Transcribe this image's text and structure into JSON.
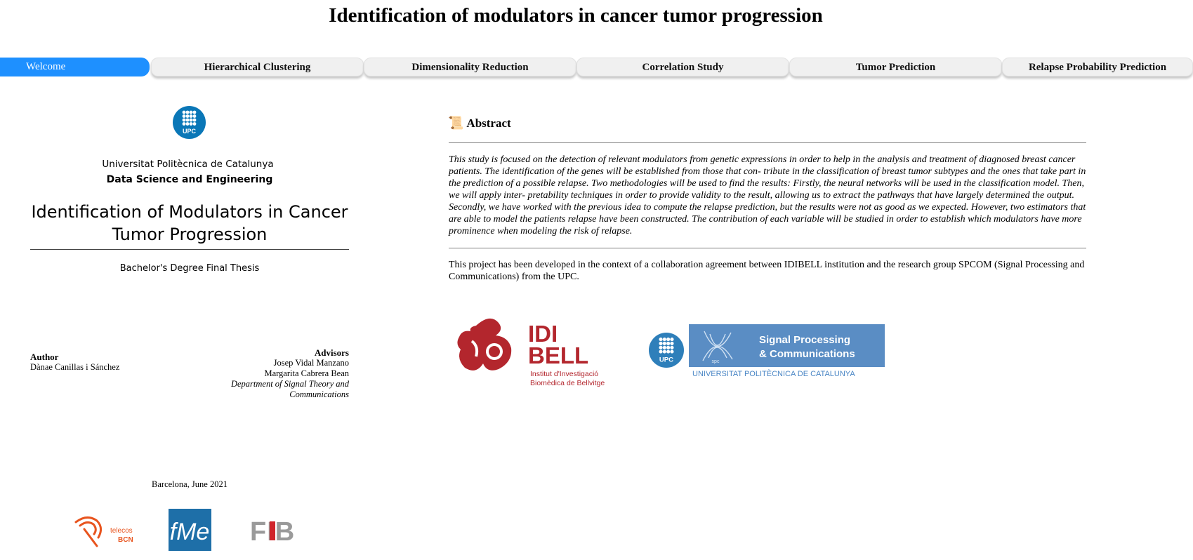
{
  "app": {
    "title": "Identification of modulators in cancer tumor progression"
  },
  "tabs": [
    {
      "label": "Welcome",
      "active": true
    },
    {
      "label": "Hierarchical Clustering",
      "active": false
    },
    {
      "label": "Dimensionality Reduction",
      "active": false
    },
    {
      "label": "Correlation Study",
      "active": false
    },
    {
      "label": "Tumor Prediction",
      "active": false
    },
    {
      "label": "Relapse Probability Prediction",
      "active": false
    }
  ],
  "cover": {
    "logo_text": "UPC",
    "university": "Universitat Politècnica de Catalunya",
    "department": "Data Science and Engineering",
    "title_line1": "Identification of Modulators in Cancer",
    "title_line2": "Tumor Progression",
    "degree": "Bachelor's Degree Final Thesis",
    "author_heading": "Author",
    "author_name": "Dànae Canillas i Sánchez",
    "advisors_heading": "Advisors",
    "advisor_1": "Josep Vidal Manzano",
    "advisor_2": "Margarita Cabrera Bean",
    "advisors_dept": "Department of Signal Theory and Communications",
    "place_date": "Barcelona, June 2021",
    "footer_logos": {
      "telecos_line1": "telecos",
      "telecos_line2": "BCN",
      "fme": "fMe",
      "fib": "FIB"
    }
  },
  "abstract": {
    "icon": "📜",
    "heading": "Abstract",
    "text": "This study is focused on the detection of relevant modulators from genetic expressions in order to help in the analysis and treatment of diagnosed breast cancer patients. The identification of the genes will be established from those that con- tribute in the classification of breast tumor subtypes and the ones that take part in the prediction of a possible relapse. Two methodologies will be used to find the results: Firstly, the neural networks will be used in the classification model. Then, we will apply inter- pretability techniques in order to provide validity to the result, allowing us to extract the pathways that have largely determined the output. Secondly, we have worked with the previous idea to compute the relapse prediction, but the results were not as good as we expected. However, two estimators that are able to model the patients relapse have been constructed. The contribution of each variable will be studied in order to establish which modulators have more prominence when modeling the risk of relapse.",
    "context": "This project has been developed in the context of a collaboration agreement between IDIBELL institution and the research group SPCOM (Signal Processing and Communications) from the UPC."
  },
  "partner_logos": {
    "idibell_line1": "IDI",
    "idibell_line2": "BELL",
    "idibell_sub1": "Institut d'Investigació",
    "idibell_sub2": "Biomèdica de Bellvitge",
    "upc": "UPC",
    "spc": "spc",
    "spcom_line1": "Signal Processing",
    "spcom_line2": "& Communications",
    "spcom_univ": "UNIVERSITAT POLITÈCNICA DE CATALUNYA"
  },
  "colors": {
    "accent": "#1e90ff",
    "tab_bg": "#f0f0f0",
    "upc_blue": "#0a77b7",
    "idibell_red": "#b3262d",
    "spcom_blue": "#5a8dc4",
    "telecos_orange": "#e8541e",
    "fme_blue": "#1e6fa8",
    "fib_gray": "#9a9a9a",
    "fib_red": "#d0242b"
  }
}
